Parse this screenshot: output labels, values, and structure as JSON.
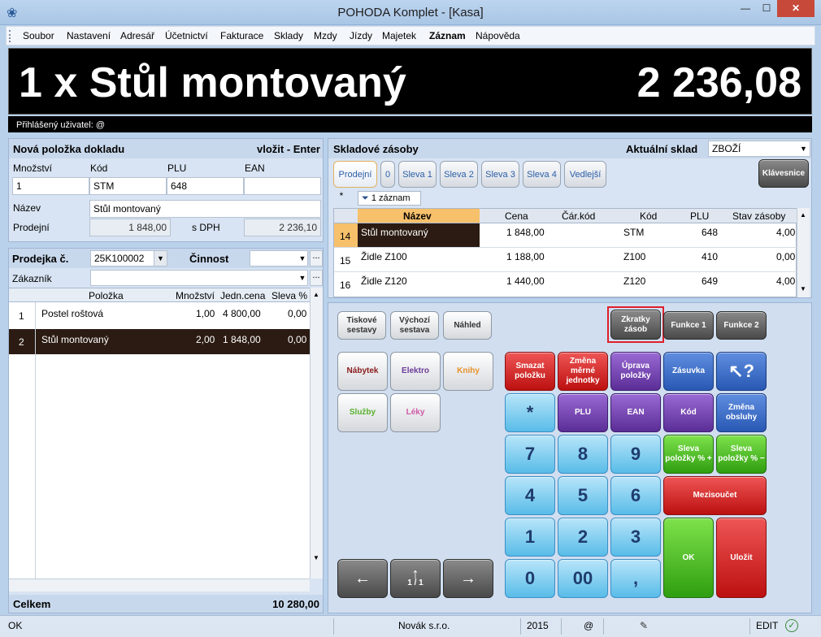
{
  "window": {
    "title": "POHODA Komplet - [Kasa]",
    "min": "—",
    "max": "☐",
    "close": "✕",
    "app_icon": "app-logo-icon"
  },
  "menu": [
    "Soubor",
    "Nastavení",
    "Adresář",
    "Účetnictví",
    "Fakturace",
    "Sklady",
    "Mzdy",
    "Jízdy",
    "Majetek",
    "Záznam",
    "Nápověda"
  ],
  "display": {
    "qty_item": "1 x  Stůl montovaný",
    "total": "2 236,08",
    "user": "Přihlášený uživatel: @"
  },
  "new_item": {
    "header": "Nová položka dokladu",
    "action": "vložit - Enter",
    "labels": {
      "qty": "Množství",
      "code": "Kód",
      "plu": "PLU",
      "ean": "EAN",
      "name": "Název",
      "price": "Prodejní",
      "vat": "s DPH"
    },
    "values": {
      "qty": "1",
      "code": "STM",
      "plu": "648",
      "ean": "",
      "name": "Stůl montovaný",
      "price": "1 848,00",
      "price_vat": "2 236,10"
    }
  },
  "receipt": {
    "label": "Prodejka č.",
    "number": "25K100002",
    "activity_label": "Činnost",
    "activity": "",
    "customer_label": "Zákazník",
    "customer": "",
    "columns": [
      "Položka",
      "Množství",
      "Jedn.cena",
      "Sleva %"
    ],
    "rows": [
      {
        "n": "1",
        "item": "Postel roštová",
        "qty": "1,00",
        "price": "4 800,00",
        "disc": "0,00"
      },
      {
        "n": "2",
        "item": "Stůl montovaný",
        "qty": "2,00",
        "price": "1 848,00",
        "disc": "0,00"
      }
    ],
    "total_label": "Celkem",
    "total": "10 280,00",
    "more": "..."
  },
  "stock": {
    "header": "Skladové zásoby",
    "warehouse_label": "Aktuální sklad",
    "warehouse": "ZBOŽÍ",
    "tabs": [
      "Prodejní",
      "0",
      "Sleva 1",
      "Sleva 2",
      "Sleva 3",
      "Sleva 4",
      "Vedlejší"
    ],
    "keyboard": "Klávesnice",
    "filter_star": "*",
    "filter": "1 záznam",
    "columns": [
      "Název",
      "Cena",
      "Čár.kód",
      "Kód",
      "PLU",
      "Stav zásoby"
    ],
    "rows": [
      {
        "n": "14",
        "name": "Stůl montovaný",
        "price": "1 848,00",
        "bar": "",
        "code": "STM",
        "plu": "648",
        "stock": "4,00"
      },
      {
        "n": "15",
        "name": "Židle Z100",
        "price": "1 188,00",
        "bar": "",
        "code": "Z100",
        "plu": "410",
        "stock": "0,00"
      },
      {
        "n": "16",
        "name": "Židle Z120",
        "price": "1 440,00",
        "bar": "",
        "code": "Z120",
        "plu": "649",
        "stock": "4,00"
      }
    ]
  },
  "keypad": {
    "top": [
      "Tiskové sestavy",
      "Výchozí sestava",
      "Náhled",
      "Zkratky zásob",
      "Funkce 1",
      "Funkce 2"
    ],
    "groups": [
      "Nábytek",
      "Elektro",
      "Knihy",
      "Služby",
      "Léky"
    ],
    "nav": {
      "left": "←",
      "up": "↑",
      "page": "1 / 1",
      "right": "→"
    },
    "fn": {
      "smazat": "Smazat položku",
      "zmena": "Změna měrné jednotky",
      "uprava": "Úprava položky",
      "zasuvka": "Zásuvka",
      "help": "↖?",
      "star": "*",
      "plu": "PLU",
      "ean": "EAN",
      "kod": "Kód",
      "obsluha": "Změna obsluhy",
      "sleva_plus": "Sleva položky % +",
      "sleva_minus": "Sleva položky % −",
      "mezisoucet": "Mezisoučet",
      "ok": "OK",
      "ulozit": "Uložit"
    },
    "digits": [
      "7",
      "8",
      "9",
      "4",
      "5",
      "6",
      "1",
      "2",
      "3",
      "0",
      "00",
      ","
    ]
  },
  "status": {
    "left": "OK",
    "company": "Novák s.r.o.",
    "year": "2015",
    "at": "@",
    "mode": "EDIT"
  },
  "colors": {
    "accent_orange": "#f7c06b",
    "selected_row": "#2b1b12",
    "display_bg": "#000000"
  }
}
